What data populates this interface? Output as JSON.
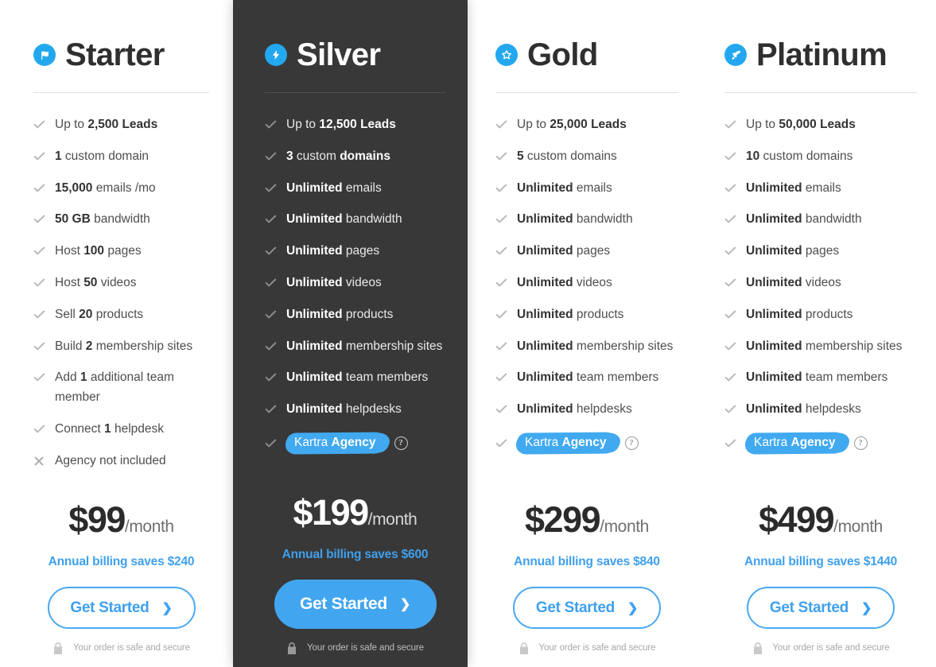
{
  "accent_blue": "#41a9f0",
  "dark_panel": "#383838",
  "cta_label": "Get Started",
  "cta_chevron": "chevron-right-icon",
  "secure_text": "Your order is safe and secure",
  "help_glyph": "?",
  "plans": [
    {
      "id": "starter",
      "name": "Starter",
      "icon": "flag-icon",
      "featured": false,
      "price_amount": "$99",
      "price_period": "/month",
      "annual_note": "Annual billing saves $240",
      "features": [
        {
          "mark": "check-icon",
          "pre": "Up to ",
          "bold": "2,500 Leads",
          "post": ""
        },
        {
          "mark": "check-icon",
          "pre": "",
          "bold": "1",
          "post": " custom domain"
        },
        {
          "mark": "check-icon",
          "pre": "",
          "bold": "15,000",
          "post": " emails /mo"
        },
        {
          "mark": "check-icon",
          "pre": "",
          "bold": "50 GB",
          "post": " bandwidth"
        },
        {
          "mark": "check-icon",
          "pre": "Host ",
          "bold": "100",
          "post": " pages"
        },
        {
          "mark": "check-icon",
          "pre": "Host ",
          "bold": "50",
          "post": " videos"
        },
        {
          "mark": "check-icon",
          "pre": "Sell ",
          "bold": "20",
          "post": " products"
        },
        {
          "mark": "check-icon",
          "pre": "Build ",
          "bold": "2",
          "post": " membership sites"
        },
        {
          "mark": "check-icon",
          "pre": "Add ",
          "bold": "1",
          "post": " additional team member"
        },
        {
          "mark": "check-icon",
          "pre": "Connect ",
          "bold": "1",
          "post": " helpdesk"
        },
        {
          "mark": "cross-icon",
          "pre": "Agency not included",
          "bold": "",
          "post": ""
        }
      ],
      "agency": null
    },
    {
      "id": "silver",
      "name": "Silver",
      "icon": "lightning-bolt-icon",
      "featured": true,
      "price_amount": "$199",
      "price_period": "/month",
      "annual_note": "Annual billing saves $600",
      "features": [
        {
          "mark": "check-icon",
          "pre": "Up to ",
          "bold": "12,500 Leads",
          "post": ""
        },
        {
          "mark": "check-icon",
          "pre": "",
          "bold": "3",
          "post": " custom ",
          "bold2": "domains"
        },
        {
          "mark": "check-icon",
          "pre": "",
          "bold": "Unlimited",
          "post": " emails"
        },
        {
          "mark": "check-icon",
          "pre": "",
          "bold": "Unlimited",
          "post": " bandwidth"
        },
        {
          "mark": "check-icon",
          "pre": "",
          "bold": "Unlimited",
          "post": " pages"
        },
        {
          "mark": "check-icon",
          "pre": "",
          "bold": "Unlimited",
          "post": " videos"
        },
        {
          "mark": "check-icon",
          "pre": "",
          "bold": "Unlimited",
          "post": " products"
        },
        {
          "mark": "check-icon",
          "pre": "",
          "bold": "Unlimited",
          "post": " membership sites"
        },
        {
          "mark": "check-icon",
          "pre": "",
          "bold": "Unlimited",
          "post": " team members"
        },
        {
          "mark": "check-icon",
          "pre": "",
          "bold": "Unlimited",
          "post": " helpdesks"
        }
      ],
      "agency": {
        "mark": "check-icon",
        "pre": "Kartra ",
        "bold": "Agency"
      }
    },
    {
      "id": "gold",
      "name": "Gold",
      "icon": "star-icon",
      "featured": false,
      "price_amount": "$299",
      "price_period": "/month",
      "annual_note": "Annual billing saves $840",
      "features": [
        {
          "mark": "check-icon",
          "pre": "Up to ",
          "bold": "25,000 Leads",
          "post": ""
        },
        {
          "mark": "check-icon",
          "pre": "",
          "bold": "5",
          "post": " custom domains"
        },
        {
          "mark": "check-icon",
          "pre": "",
          "bold": "Unlimited",
          "post": " emails"
        },
        {
          "mark": "check-icon",
          "pre": "",
          "bold": "Unlimited",
          "post": " bandwidth"
        },
        {
          "mark": "check-icon",
          "pre": "",
          "bold": "Unlimited",
          "post": " pages"
        },
        {
          "mark": "check-icon",
          "pre": "",
          "bold": "Unlimited",
          "post": " videos"
        },
        {
          "mark": "check-icon",
          "pre": "",
          "bold": "Unlimited",
          "post": " products"
        },
        {
          "mark": "check-icon",
          "pre": "",
          "bold": "Unlimited",
          "post": " membership sites"
        },
        {
          "mark": "check-icon",
          "pre": "",
          "bold": "Unlimited",
          "post": " team members"
        },
        {
          "mark": "check-icon",
          "pre": "",
          "bold": "Unlimited",
          "post": " helpdesks"
        }
      ],
      "agency": {
        "mark": "check-icon",
        "pre": "Kartra ",
        "bold": "Agency"
      }
    },
    {
      "id": "platinum",
      "name": "Platinum",
      "icon": "rocket-icon",
      "featured": false,
      "price_amount": "$499",
      "price_period": "/month",
      "annual_note": "Annual billing saves $1440",
      "features": [
        {
          "mark": "check-icon",
          "pre": "Up to ",
          "bold": "50,000 Leads",
          "post": ""
        },
        {
          "mark": "check-icon",
          "pre": "",
          "bold": "10",
          "post": " custom domains"
        },
        {
          "mark": "check-icon",
          "pre": "",
          "bold": "Unlimited",
          "post": " emails"
        },
        {
          "mark": "check-icon",
          "pre": "",
          "bold": "Unlimited",
          "post": " bandwidth"
        },
        {
          "mark": "check-icon",
          "pre": "",
          "bold": "Unlimited",
          "post": " pages"
        },
        {
          "mark": "check-icon",
          "pre": "",
          "bold": "Unlimited",
          "post": " videos"
        },
        {
          "mark": "check-icon",
          "pre": "",
          "bold": "Unlimited",
          "post": " products"
        },
        {
          "mark": "check-icon",
          "pre": "",
          "bold": "Unlimited",
          "post": " membership sites"
        },
        {
          "mark": "check-icon",
          "pre": "",
          "bold": "Unlimited",
          "post": " team members"
        },
        {
          "mark": "check-icon",
          "pre": "",
          "bold": "Unlimited",
          "post": " helpdesks"
        }
      ],
      "agency": {
        "mark": "check-icon",
        "pre": "Kartra ",
        "bold": "Agency"
      }
    }
  ]
}
